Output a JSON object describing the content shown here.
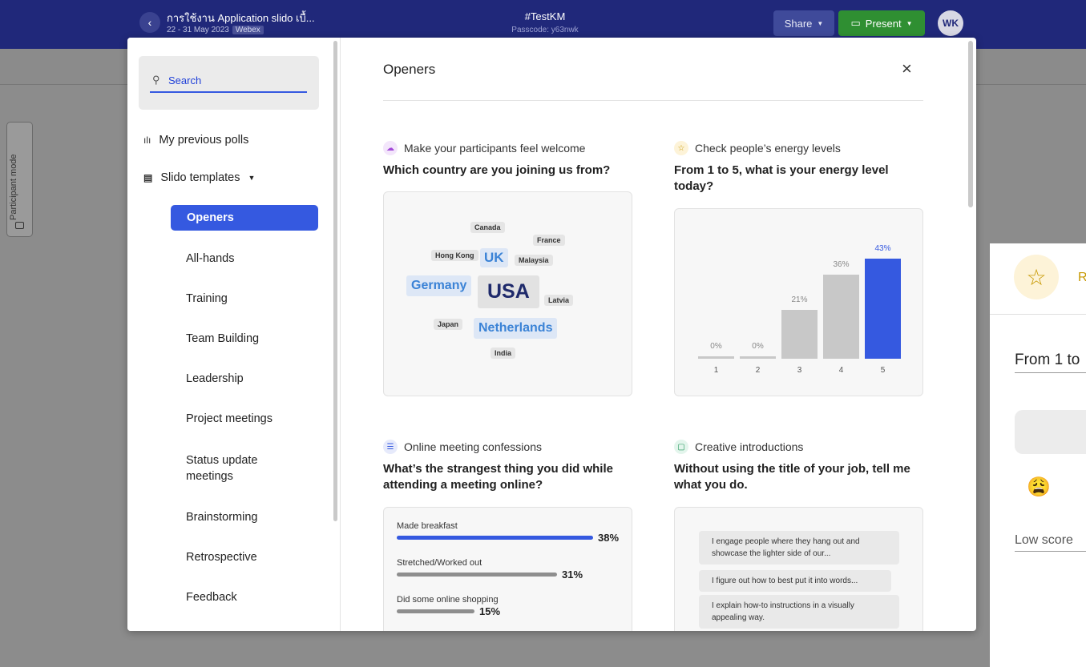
{
  "event": {
    "title": "การใช้งาน Application slido เบื้...",
    "dates": "22 - 31 May 2023",
    "platform": "Webex",
    "code": "#TestKM",
    "passcode": "Passcode: y63nwk"
  },
  "header": {
    "share_label": "Share",
    "present_label": "Present",
    "avatar_initials": "WK"
  },
  "participant_mode_label": "Participant mode",
  "bg_card": {
    "label_partial": "R",
    "question_partial": "From 1 to",
    "low_partial": "Low score",
    "emoji": "😩"
  },
  "modal": {
    "search_placeholder": "Search",
    "previous_polls": "My previous polls",
    "templates_label": "Slido templates",
    "templates": [
      "Openers",
      "All-hands",
      "Training",
      "Team Building",
      "Leadership",
      "Project meetings",
      "Status update meetings",
      "Brainstorming",
      "Retrospective",
      "Feedback"
    ],
    "title": "Openers",
    "close": "×",
    "cards": [
      {
        "category": "Make your participants feel welcome",
        "question": "Which country are you joining us from?",
        "words": [
          "Canada",
          "France",
          "Hong Kong",
          "UK",
          "Malaysia",
          "Germany",
          "USA",
          "Latvia",
          "Japan",
          "Netherlands",
          "India"
        ]
      },
      {
        "category": "Check people’s energy levels",
        "question": "From 1 to 5, what is your energy level today?",
        "bars": [
          {
            "label": "1",
            "pct": "0%",
            "value": 0
          },
          {
            "label": "2",
            "pct": "0%",
            "value": 0
          },
          {
            "label": "3",
            "pct": "21%",
            "value": 21
          },
          {
            "label": "4",
            "pct": "36%",
            "value": 36
          },
          {
            "label": "5",
            "pct": "43%",
            "value": 43
          }
        ]
      },
      {
        "category": "Online meeting confessions",
        "question": "What’s the strangest thing you did while attending a meeting online?",
        "options": [
          {
            "label": "Made breakfast",
            "pct": "38%",
            "value": 38
          },
          {
            "label": "Stretched/Worked out",
            "pct": "31%",
            "value": 31
          },
          {
            "label": "Did some online shopping",
            "pct": "15%",
            "value": 15
          }
        ]
      },
      {
        "category": "Creative introductions",
        "question": "Without using the title of your job, tell me what you do.",
        "answers": [
          "I engage people where they hang out and showcase the lighter side of our...",
          "I figure out how to best put it into words...",
          "I explain how-to instructions in a visually appealing way."
        ]
      }
    ]
  },
  "colors": {
    "accent": "#3559e0",
    "header": "#20287a",
    "present": "#2f8f32",
    "bar_gray": "#c8c8c8"
  }
}
